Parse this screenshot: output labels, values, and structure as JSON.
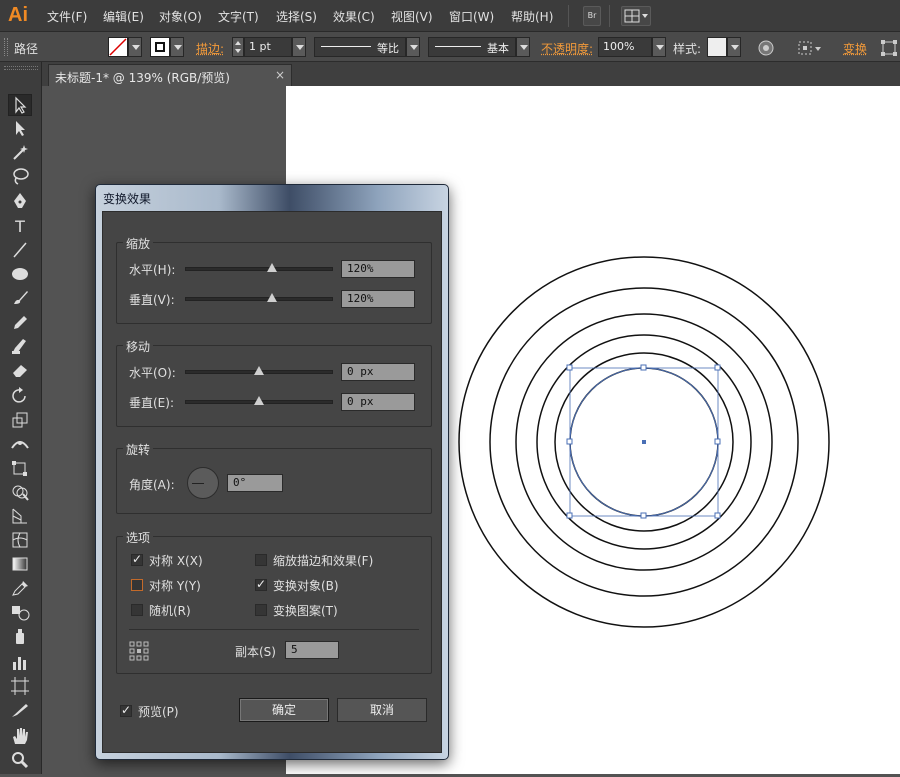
{
  "app": {
    "logo": "Ai"
  },
  "menu": [
    "文件(F)",
    "编辑(E)",
    "对象(O)",
    "文字(T)",
    "选择(S)",
    "效果(C)",
    "视图(V)",
    "窗口(W)",
    "帮助(H)"
  ],
  "menubar": {
    "bridge_button": "Br"
  },
  "control_bar": {
    "selection_type": "路径",
    "stroke_label": "描边:",
    "stroke_weight": "1 pt",
    "stroke_profile": "等比",
    "brush": "基本",
    "opacity_label": "不透明度:",
    "opacity_value": "100%",
    "style_label": "样式:",
    "transform_label": "变换"
  },
  "document_tab": {
    "title": "未标题-1* @ 139% (RGB/预览)",
    "close": "×"
  },
  "toolbar": {
    "type_tool_glyph": "T"
  },
  "dialog": {
    "title": "变换效果",
    "scale": {
      "title": "缩放",
      "horizontal_label": "水平(H):",
      "horizontal_value": "120%",
      "vertical_label": "垂直(V):",
      "vertical_value": "120%"
    },
    "move": {
      "title": "移动",
      "horizontal_label": "水平(O):",
      "horizontal_value": "0 px",
      "vertical_label": "垂直(E):",
      "vertical_value": "0 px"
    },
    "rotate": {
      "title": "旋转",
      "angle_label": "角度(A):",
      "angle_value": "0°"
    },
    "options": {
      "title": "选项",
      "reflect_x": {
        "label": "对称 X(X)",
        "checked": true
      },
      "reflect_y": {
        "label": "对称 Y(Y)",
        "checked": false
      },
      "random": {
        "label": "随机(R)",
        "checked": false
      },
      "scale_strokes": {
        "label": "缩放描边和效果(F)",
        "checked": false
      },
      "transform_objects": {
        "label": "变换对象(B)",
        "checked": true
      },
      "transform_patterns": {
        "label": "变换图案(T)",
        "checked": false
      },
      "copies_label": "副本(S)",
      "copies_value": "5"
    },
    "preview": {
      "label": "预览(P)",
      "checked": true
    },
    "ok_label": "确定",
    "cancel_label": "取消"
  },
  "colors": {
    "selection": "#4a6fb5",
    "logo": "#f08a24",
    "highlight_label": "#f29a3a"
  }
}
